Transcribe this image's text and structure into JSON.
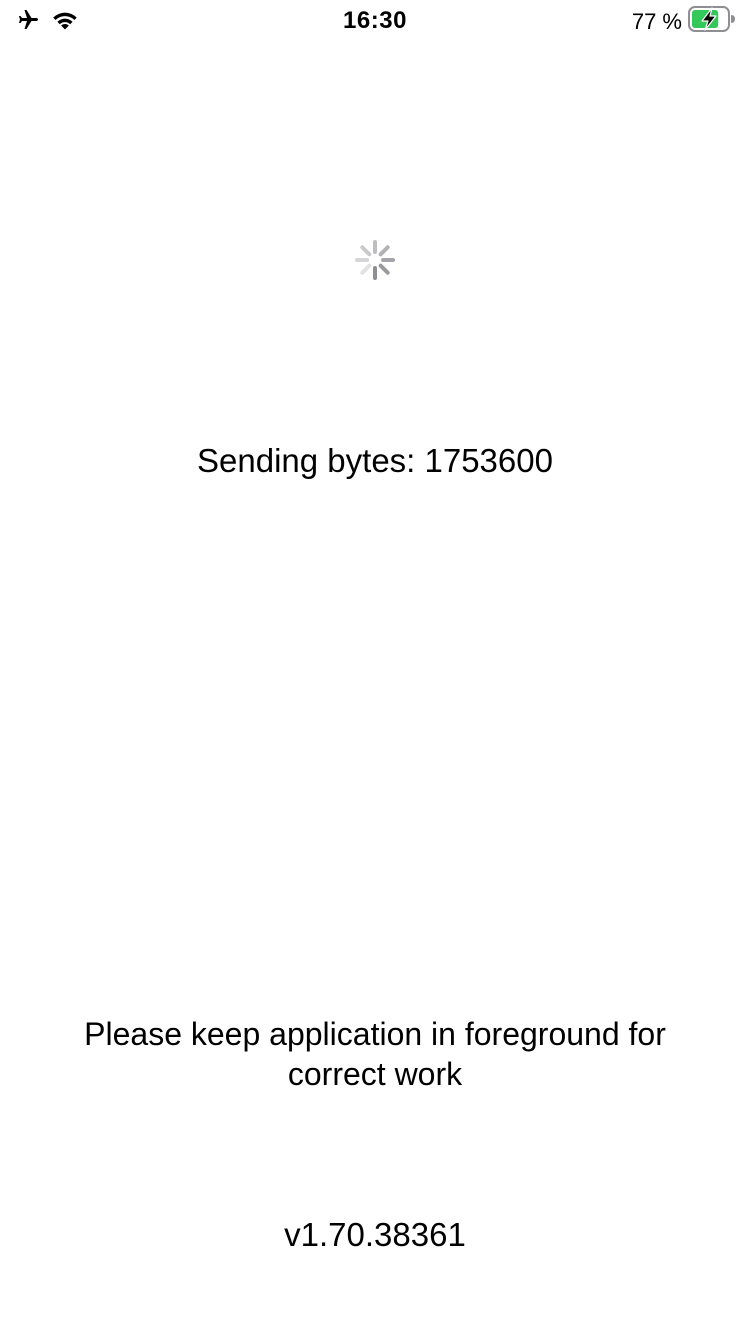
{
  "status_bar": {
    "time": "16:30",
    "battery_percent_text": "77 %",
    "battery_level": 0.77,
    "icons": [
      "airplane-icon",
      "wifi-icon",
      "battery-charging-icon"
    ],
    "battery_color": "#34c759"
  },
  "main": {
    "spinner_icon": "loading-spinner-icon",
    "status_message": "Sending bytes: 1753600",
    "notice": "Please keep application in foreground for correct work",
    "version": "v1.70.38361"
  }
}
